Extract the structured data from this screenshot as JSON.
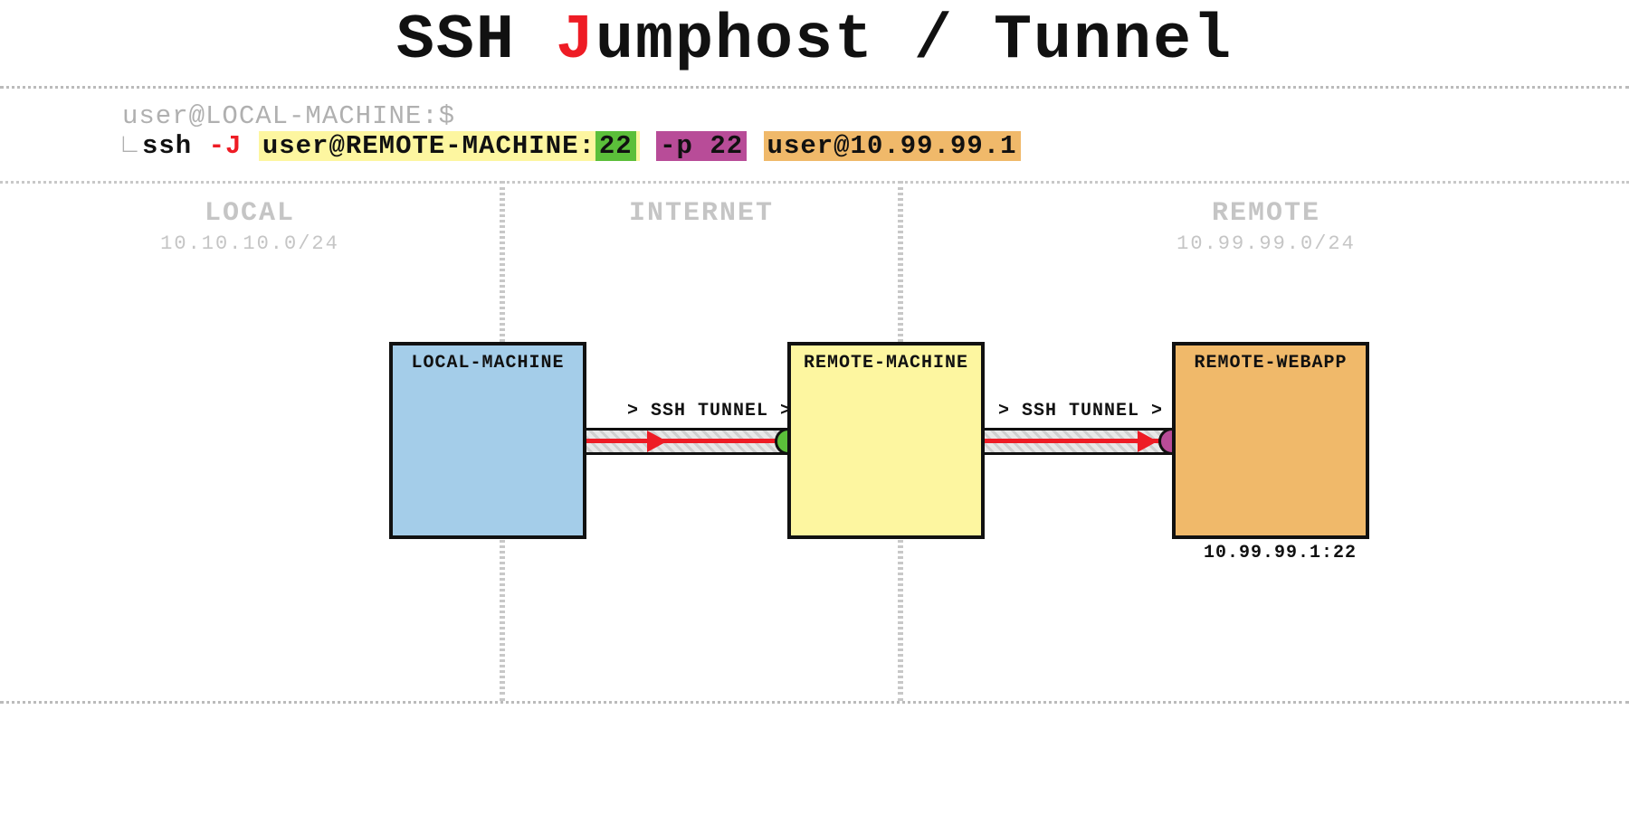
{
  "title": {
    "pre": "SSH ",
    "accent": "J",
    "post": "umphost / Tunnel"
  },
  "command": {
    "prompt": "user@LOCAL-MACHINE:$",
    "cmd": "ssh ",
    "flagJ": "-J",
    "jumpHost": "user@REMOTE-MACHINE:",
    "jumpPort": "22",
    "flagP": "-p 22",
    "target": "user@10.99.99.1"
  },
  "zones": {
    "local": {
      "label": "LOCAL",
      "subnet": "10.10.10.0/24"
    },
    "internet": {
      "label": "INTERNET",
      "subnet": ""
    },
    "remote": {
      "label": "REMOTE",
      "subnet": "10.99.99.0/24"
    }
  },
  "boxes": {
    "local": {
      "label": "LOCAL-MACHINE"
    },
    "jump": {
      "label": "REMOTE-MACHINE"
    },
    "target": {
      "label": "REMOTE-WEBAPP",
      "caption": "10.99.99.1:22"
    }
  },
  "tunnels": {
    "t1": "> SSH TUNNEL >",
    "t2": "> SSH TUNNEL >"
  }
}
